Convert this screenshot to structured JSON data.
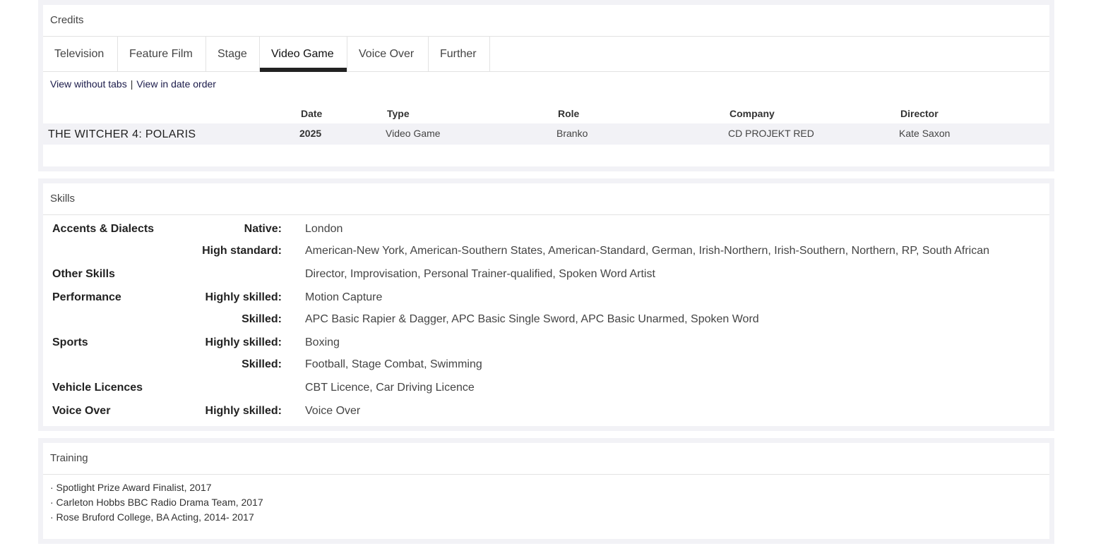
{
  "credits": {
    "title": "Credits",
    "tabs": [
      "Television",
      "Feature Film",
      "Stage",
      "Video Game",
      "Voice Over",
      "Further"
    ],
    "active_tab": "Video Game",
    "view_without_tabs": "View without tabs",
    "separator": "|",
    "view_date_order": "View in date order",
    "headers": {
      "date": "Date",
      "type": "Type",
      "role": "Role",
      "company": "Company",
      "director": "Director"
    },
    "rows": [
      {
        "title": "THE WITCHER 4: POLARIS",
        "date": "2025",
        "type": "Video Game",
        "role": "Branko",
        "company": "CD PROJEKT RED",
        "director": "Kate Saxon"
      }
    ]
  },
  "skills": {
    "title": "Skills",
    "rows": [
      {
        "category": "Accents & Dialects",
        "level": "Native:",
        "value": "London"
      },
      {
        "category": "",
        "level": "High standard:",
        "value": "American-New York, American-Southern States, American-Standard, German, Irish-Northern, Irish-Southern, Northern, RP, South African"
      },
      {
        "category": "Other Skills",
        "level": "",
        "value": "Director, Improvisation, Personal Trainer-qualified, Spoken Word Artist"
      },
      {
        "category": "Performance",
        "level": "Highly skilled:",
        "value": "Motion Capture"
      },
      {
        "category": "",
        "level": "Skilled:",
        "value": "APC Basic Rapier & Dagger, APC Basic Single Sword, APC Basic Unarmed, Spoken Word"
      },
      {
        "category": "Sports",
        "level": "Highly skilled:",
        "value": "Boxing"
      },
      {
        "category": "",
        "level": "Skilled:",
        "value": "Football, Stage Combat, Swimming"
      },
      {
        "category": "Vehicle Licences",
        "level": "",
        "value": "CBT Licence, Car Driving Licence"
      },
      {
        "category": "Voice Over",
        "level": "Highly skilled:",
        "value": "Voice Over"
      }
    ]
  },
  "training": {
    "title": "Training",
    "items": [
      "· Spotlight Prize Award Finalist, 2017",
      "· Carleton Hobbs BBC Radio Drama Team, 2017",
      "· Rose Bruford College, BA Acting, 2014- 2017"
    ]
  }
}
